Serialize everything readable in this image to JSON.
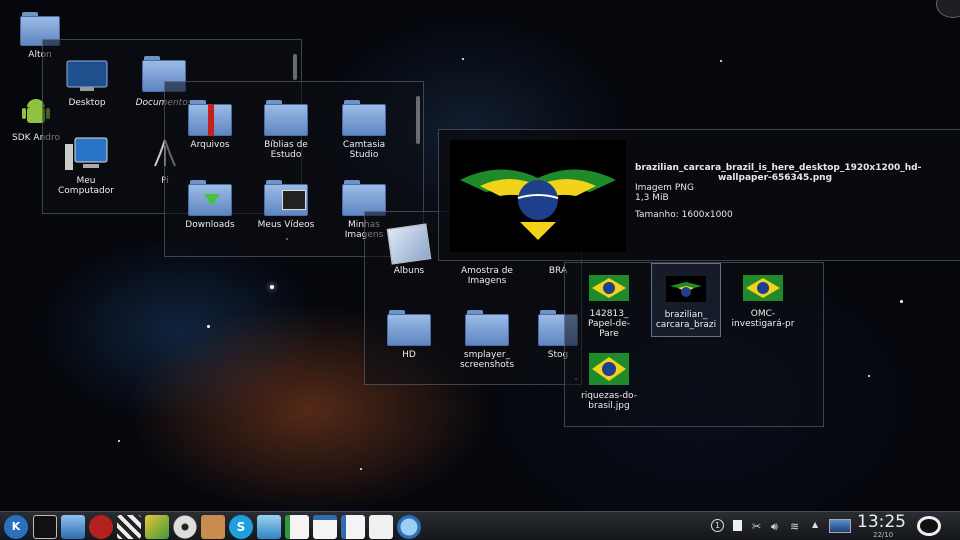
{
  "desktop_icons": [
    {
      "label": "Alton"
    },
    {
      "label": "SDK Andro"
    }
  ],
  "window_places": {
    "items": [
      {
        "label": "Desktop"
      },
      {
        "label": "Documentos"
      },
      {
        "label": "Meu Computador"
      },
      {
        "label": "Pi"
      }
    ]
  },
  "window_home": {
    "items": [
      {
        "label": "Arquivos"
      },
      {
        "label": "Bíblias de Estudo"
      },
      {
        "label": "Camtasia Studio"
      },
      {
        "label": "Downloads"
      },
      {
        "label": "Meus Vídeos"
      },
      {
        "label": "Minhas Imagens"
      }
    ]
  },
  "window_images": {
    "items": [
      {
        "label": "Albuns"
      },
      {
        "label": "Amostra de Imagens"
      },
      {
        "label": "BRA"
      },
      {
        "label": "HD"
      },
      {
        "label": "smplayer_ screenshots"
      },
      {
        "label": "Stog"
      }
    ]
  },
  "window_brazil": {
    "items": [
      {
        "label": "142813_ Papel-de-Pare"
      },
      {
        "label": "brazilian_ carcara_brazi"
      },
      {
        "label": "OMC- investigará-pr"
      },
      {
        "label": "riquezas-do- brasil.jpg"
      }
    ]
  },
  "preview": {
    "filename": "brazilian_carcara_brazil_is_here_desktop_1920x1200_hd-wallpaper-656345.png",
    "type": "Imagem PNG",
    "size": "1,3 MiB",
    "dimensions": "Tamanho: 1600x1000"
  },
  "taskbar": {
    "clock_time": "13:25",
    "clock_date": "22/10",
    "notification_count": "1",
    "launchers": [
      "kde-menu-icon",
      "terminal-icon",
      "system-settings-icon",
      "red-app-icon",
      "clapper-icon",
      "photo-app-icon",
      "disc-icon",
      "archive-icon",
      "skype-icon",
      "mail-icon",
      "spreadsheet-icon",
      "presentation-icon",
      "writer-icon",
      "text-doc-icon",
      "inspect-icon"
    ]
  },
  "colors": {
    "accent": "#5e86c2",
    "panel_border": "#a0aabe",
    "flag_green": "#1f8a2a",
    "flag_yellow": "#f2d21a",
    "flag_blue": "#1d3f8c"
  }
}
